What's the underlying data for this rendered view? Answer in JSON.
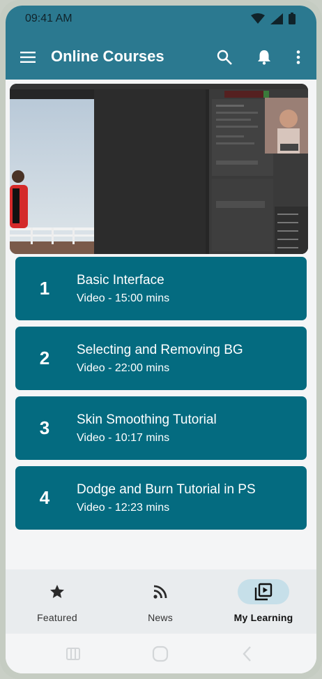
{
  "status_bar": {
    "time": "09:41 AM"
  },
  "app_bar": {
    "title": "Online Courses"
  },
  "lessons": [
    {
      "number": "1",
      "title": "Basic Interface",
      "subtitle": "Video - 15:00 mins"
    },
    {
      "number": "2",
      "title": "Selecting and Removing BG",
      "subtitle": "Video - 22:00 mins"
    },
    {
      "number": "3",
      "title": "Skin Smoothing Tutorial",
      "subtitle": "Video - 10:17 mins"
    },
    {
      "number": "4",
      "title": "Dodge and Burn Tutorial in PS",
      "subtitle": "Video - 12:23 mins"
    }
  ],
  "bottom_nav": {
    "items": [
      {
        "label": "Featured",
        "icon": "star-icon",
        "active": false
      },
      {
        "label": "News",
        "icon": "rss-icon",
        "active": false
      },
      {
        "label": "My Learning",
        "icon": "video-library-icon",
        "active": true
      }
    ]
  },
  "colors": {
    "app_bar": "#2b7990",
    "lesson_card": "#046b80",
    "active_nav_pill": "#c6dfe9",
    "screen_bg": "#f4f5f6"
  }
}
